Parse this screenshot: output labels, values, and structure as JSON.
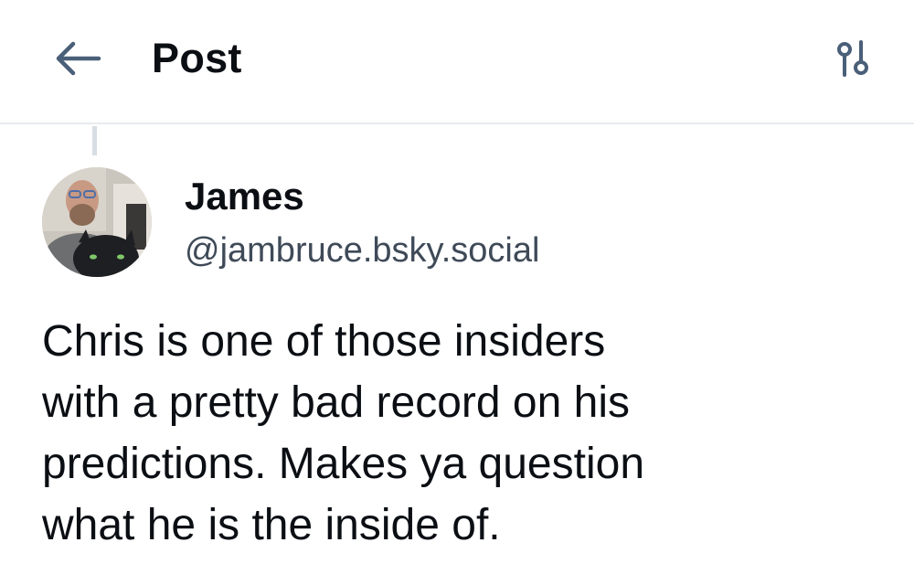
{
  "header": {
    "title": "Post",
    "back_icon": "arrow-left-icon",
    "settings_icon": "sliders-icon"
  },
  "author": {
    "name": "James",
    "handle": "@jambruce.bsky.social"
  },
  "post": {
    "text": "Chris is one of those insiders\nwith a pretty bad record on his\npredictions. Makes ya question\nwhat he is the inside of."
  },
  "colors": {
    "text": "#0b0f14",
    "muted": "#3f4a58",
    "icon": "#4a5f78",
    "divider": "#e8ebef"
  }
}
